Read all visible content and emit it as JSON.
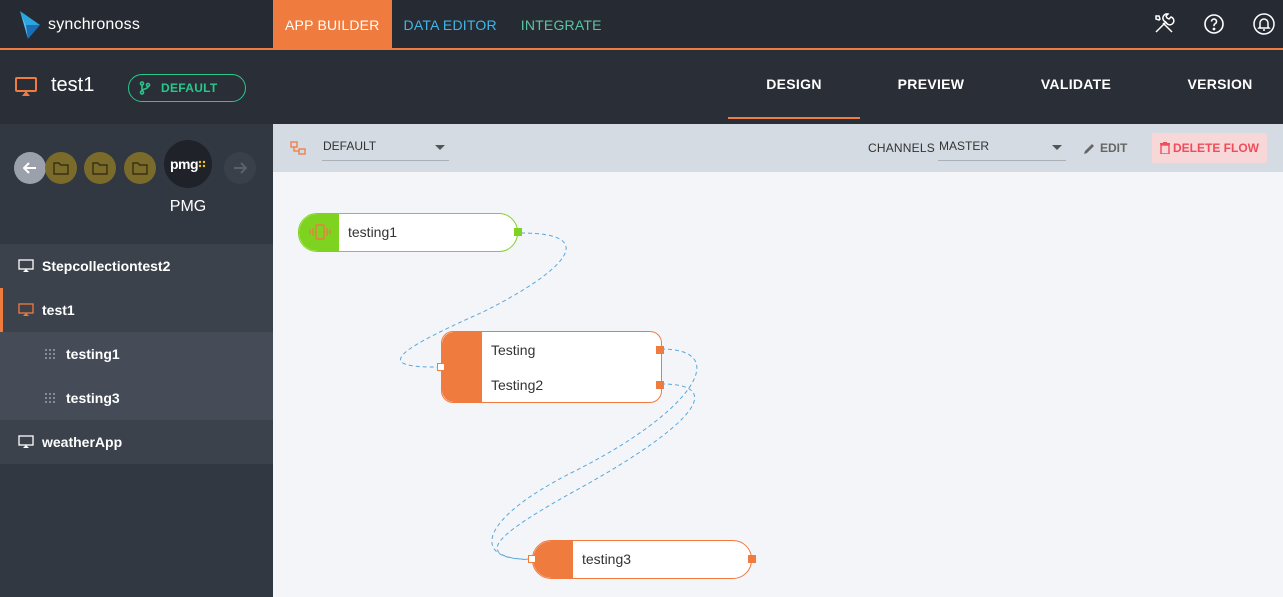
{
  "app": {
    "logo_text": "synchronoss",
    "nav": [
      "APP BUILDER",
      "DATA EDITOR",
      "INTEGRATE"
    ],
    "icons": [
      "tools-icon",
      "help-icon",
      "notification-bell-icon"
    ]
  },
  "project": {
    "title": "test1",
    "branch": "DEFAULT",
    "tabs": [
      "DESIGN",
      "PREVIEW",
      "VALIDATE",
      "VERSION"
    ],
    "active_tab": "DESIGN"
  },
  "sidebar": {
    "breadcrumb_label": "PMG",
    "breadcrumb_logo": "pmg",
    "items": [
      {
        "label": "Stepcollectiontest2",
        "level": 1
      },
      {
        "label": "test1",
        "level": 1,
        "selected": true
      },
      {
        "label": "testing1",
        "level": 2
      },
      {
        "label": "testing3",
        "level": 2
      },
      {
        "label": "weatherApp",
        "level": 1
      }
    ]
  },
  "toolbar": {
    "flow_select": "DEFAULT",
    "channels_label": "CHANNELS",
    "channel_select": "MASTER",
    "edit_label": "EDIT",
    "delete_label": "DELETE FLOW"
  },
  "flow": {
    "nodes": [
      {
        "id": "n1",
        "label": "testing1"
      },
      {
        "id": "n2",
        "labels": [
          "Testing",
          "Testing2"
        ]
      },
      {
        "id": "n3",
        "label": "testing3"
      }
    ]
  },
  "colors": {
    "accent": "#f07b3f",
    "start_node": "#7ed321",
    "branch": "#27c88a",
    "danger": "#ef4d5a",
    "link": "#3fb5e8",
    "wire": "#5aa8dc"
  }
}
